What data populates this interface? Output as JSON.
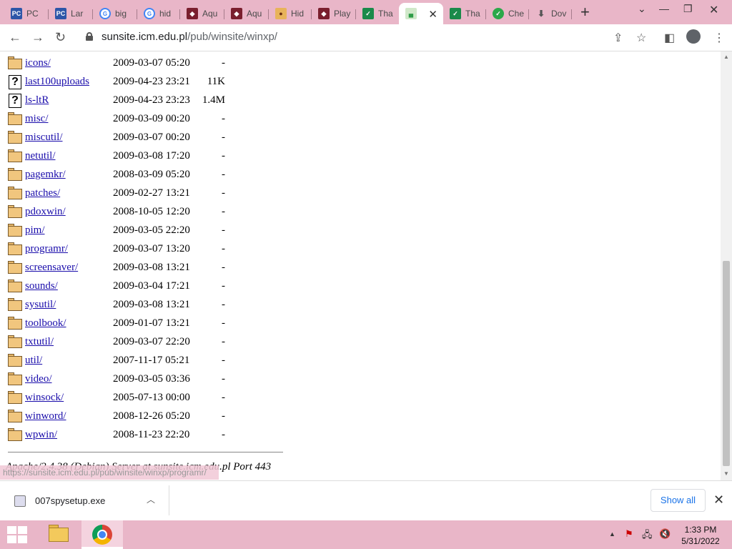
{
  "tabs": [
    {
      "label": "PC",
      "icon": "pc-icon",
      "cls": "pc",
      "glyph": "PC"
    },
    {
      "label": "Lar",
      "icon": "pc-icon",
      "cls": "pc",
      "glyph": "PC"
    },
    {
      "label": "big",
      "icon": "google-icon",
      "cls": "g",
      "glyph": "G"
    },
    {
      "label": "hid",
      "icon": "google-icon",
      "cls": "g",
      "glyph": "G"
    },
    {
      "label": "Aqu",
      "icon": "aqua-icon",
      "cls": "aq",
      "glyph": "◆"
    },
    {
      "label": "Aqu",
      "icon": "aqua-icon",
      "cls": "aq",
      "glyph": "◆"
    },
    {
      "label": "Hid",
      "icon": "hidden-object-icon",
      "cls": "hd",
      "glyph": "●"
    },
    {
      "label": "Play",
      "icon": "aqua-icon",
      "cls": "aq",
      "glyph": "◆"
    },
    {
      "label": "Tha",
      "icon": "thank-you-icon",
      "cls": "th",
      "glyph": "✓"
    },
    {
      "label": "",
      "icon": "sunsite-icon",
      "cls": "act",
      "glyph": "▄"
    },
    {
      "label": "Tha",
      "icon": "thank-you-icon",
      "cls": "th",
      "glyph": "✓"
    },
    {
      "label": "Che",
      "icon": "check-icon",
      "cls": "cw",
      "glyph": "✓"
    },
    {
      "label": "Dov",
      "icon": "download-icon",
      "cls": "dl",
      "glyph": "⬇"
    }
  ],
  "address_bar": {
    "domain": "sunsite.icm.edu.pl",
    "path": "/pub/winsite/winxp/"
  },
  "listing": [
    {
      "name": "icons/",
      "date": "2009-03-07 05:20",
      "size": "-",
      "type": "folder"
    },
    {
      "name": "last100uploads",
      "date": "2009-04-23 23:21",
      "size": "11K",
      "type": "unknown"
    },
    {
      "name": "ls-ltR",
      "date": "2009-04-23 23:23",
      "size": "1.4M",
      "type": "unknown"
    },
    {
      "name": "misc/",
      "date": "2009-03-09 00:20",
      "size": "-",
      "type": "folder"
    },
    {
      "name": "miscutil/",
      "date": "2009-03-07 00:20",
      "size": "-",
      "type": "folder"
    },
    {
      "name": "netutil/",
      "date": "2009-03-08 17:20",
      "size": "-",
      "type": "folder"
    },
    {
      "name": "pagemkr/",
      "date": "2008-03-09 05:20",
      "size": "-",
      "type": "folder"
    },
    {
      "name": "patches/",
      "date": "2009-02-27 13:21",
      "size": "-",
      "type": "folder"
    },
    {
      "name": "pdoxwin/",
      "date": "2008-10-05 12:20",
      "size": "-",
      "type": "folder"
    },
    {
      "name": "pim/",
      "date": "2009-03-05 22:20",
      "size": "-",
      "type": "folder"
    },
    {
      "name": "programr/",
      "date": "2009-03-07 13:20",
      "size": "-",
      "type": "folder"
    },
    {
      "name": "screensaver/",
      "date": "2009-03-08 13:21",
      "size": "-",
      "type": "folder"
    },
    {
      "name": "sounds/",
      "date": "2009-03-04 17:21",
      "size": "-",
      "type": "folder"
    },
    {
      "name": "sysutil/",
      "date": "2009-03-08 13:21",
      "size": "-",
      "type": "folder"
    },
    {
      "name": "toolbook/",
      "date": "2009-01-07 13:21",
      "size": "-",
      "type": "folder"
    },
    {
      "name": "txtutil/",
      "date": "2009-03-07 22:20",
      "size": "-",
      "type": "folder"
    },
    {
      "name": "util/",
      "date": "2007-11-17 05:21",
      "size": "-",
      "type": "folder"
    },
    {
      "name": "video/",
      "date": "2009-03-05 03:36",
      "size": "-",
      "type": "folder"
    },
    {
      "name": "winsock/",
      "date": "2005-07-13 00:00",
      "size": "-",
      "type": "folder"
    },
    {
      "name": "winword/",
      "date": "2008-12-26 05:20",
      "size": "-",
      "type": "folder"
    },
    {
      "name": "wpwin/",
      "date": "2008-11-23 22:20",
      "size": "-",
      "type": "folder"
    }
  ],
  "server_signature": "Apache/2.4.38 (Debian) Server at sunsite.icm.edu.pl Port 443",
  "status_url": "https://sunsite.icm.edu.pl/pub/winsite/winxp/programr/",
  "downloads": {
    "file": "007spysetup.exe",
    "show_all": "Show all"
  },
  "clock": {
    "time": "1:33 PM",
    "date": "5/31/2022"
  }
}
